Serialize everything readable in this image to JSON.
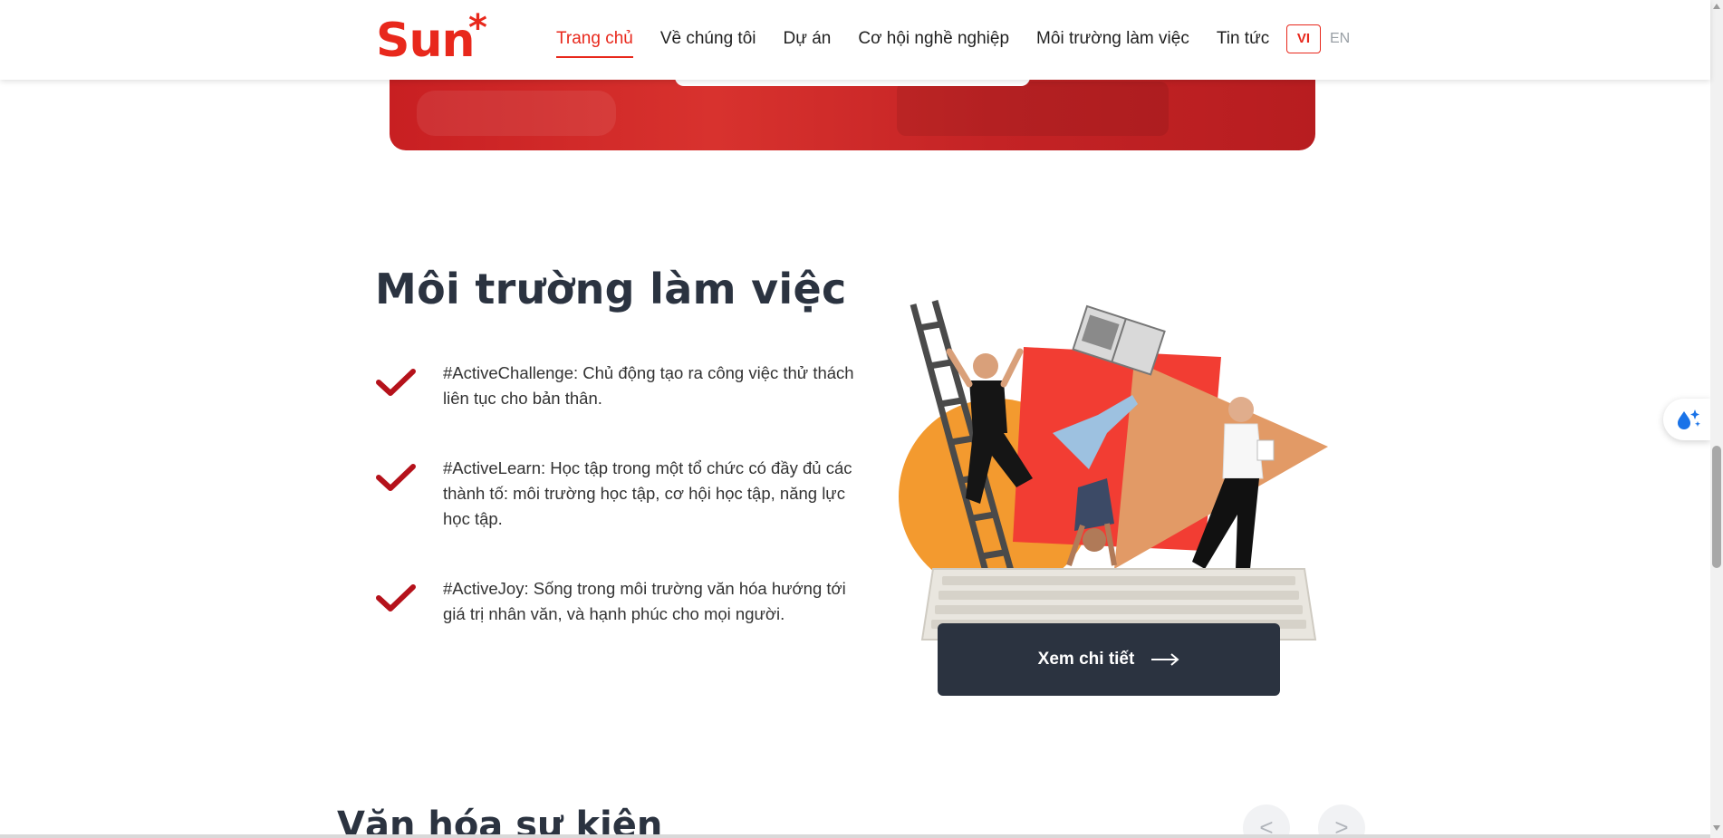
{
  "header": {
    "logo": "Sun*",
    "nav": [
      {
        "label": "Trang chủ",
        "active": true
      },
      {
        "label": "Về chúng tôi",
        "active": false
      },
      {
        "label": "Dự án",
        "active": false
      },
      {
        "label": "Cơ hội nghề nghiệp",
        "active": false
      },
      {
        "label": "Môi trường làm việc",
        "active": false
      },
      {
        "label": "Tin tức",
        "active": false
      }
    ],
    "lang": {
      "vi": "VI",
      "en": "EN"
    }
  },
  "section": {
    "title": "Môi trường làm việc",
    "items": [
      {
        "text": "#ActiveChallenge: Chủ động tạo ra công việc thử thách liên tục cho bản thân."
      },
      {
        "text": "#ActiveLearn: Học tập trong một tổ chức có đầy đủ các thành tố: môi trường học tập, cơ hội học tập, năng lực học tập."
      },
      {
        "text": "#ActiveJoy: Sống trong môi trường văn hóa hướng tới giá trị nhân văn, và hạnh phúc cho mọi người."
      }
    ],
    "cta": "Xem chi tiết"
  },
  "next_section": {
    "title": "Văn hóa sự kiện",
    "prev": "<",
    "next": ">"
  },
  "colors": {
    "brand": "#e8281c",
    "dark": "#2b3340",
    "check": "#b5121b"
  }
}
